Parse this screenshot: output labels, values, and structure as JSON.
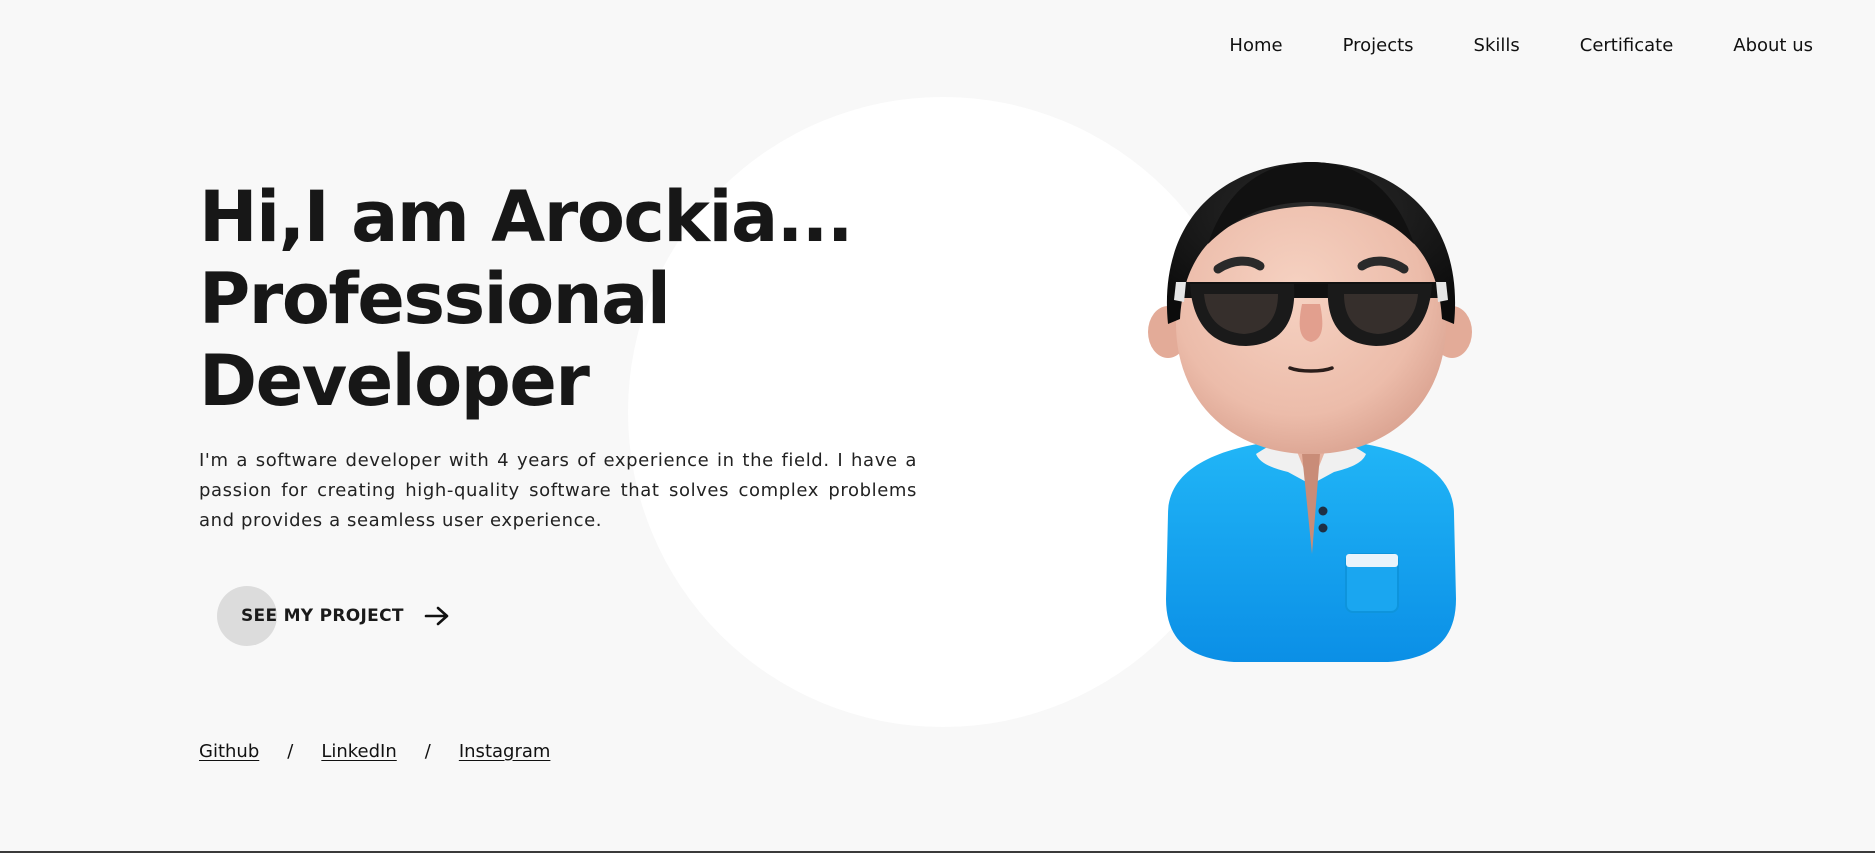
{
  "nav": {
    "items": [
      {
        "label": "Home"
      },
      {
        "label": "Projects"
      },
      {
        "label": "Skills"
      },
      {
        "label": "Certificate"
      },
      {
        "label": "About us"
      }
    ]
  },
  "hero": {
    "headline_line1": "Hi,I am Arockia...",
    "headline_line2": "Professional",
    "headline_line3": "Developer",
    "description": "I'm a software developer with 4 years of experience in the field. I have a passion for creating high-quality software that solves complex problems and provides a seamless user experience."
  },
  "cta": {
    "label": "SEE MY PROJECT",
    "icon": "arrow-right-icon"
  },
  "socials": {
    "items": [
      {
        "label": "Github"
      },
      {
        "label": "LinkedIn"
      },
      {
        "label": "Instagram"
      }
    ],
    "separator": "/"
  },
  "colors": {
    "background": "#f8f8f8",
    "circle": "#ffffff",
    "text": "#161616",
    "cta_blob": "#dcdcdc",
    "shirt": "#10a8f0"
  },
  "avatar": {
    "icon": "developer-avatar-illustration"
  }
}
